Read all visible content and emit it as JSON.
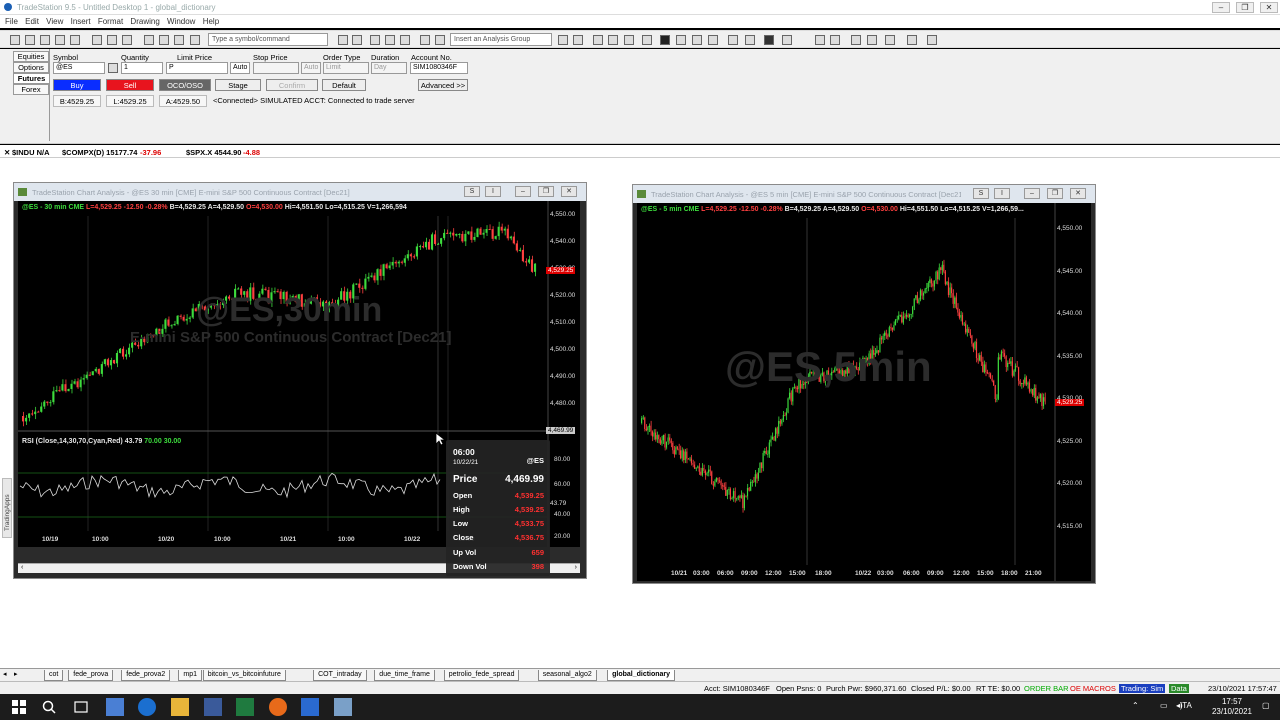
{
  "window": {
    "title": "TradeStation 9.5 - Untitled Desktop 1 - global_dictionary"
  },
  "menu": [
    "File",
    "Edit",
    "View",
    "Insert",
    "Format",
    "Drawing",
    "Window",
    "Help"
  ],
  "toolbar": {
    "command_placeholder": "Type a symbol/command",
    "analysis_group": "Insert an Analysis Group"
  },
  "order_bar": {
    "asset_tabs": [
      "Equities",
      "Options",
      "Futures",
      "Forex"
    ],
    "labels": {
      "symbol": "Symbol",
      "quantity": "Quantity",
      "limit_price": "Limit Price",
      "stop_price": "Stop Price",
      "order_type": "Order Type",
      "duration": "Duration",
      "account": "Account No."
    },
    "values": {
      "symbol": "@ES",
      "quantity": "1",
      "limit_price": "P",
      "limit_auto": "Auto",
      "stop_auto": "Auto",
      "order_type": "Limit",
      "duration": "Day",
      "account": "SIM1080346F"
    },
    "buttons": {
      "buy": "Buy",
      "sell": "Sell",
      "oco": "OCO/OSO",
      "stage": "Stage",
      "confirm": "Confirm",
      "default": "Default",
      "advanced": "Advanced >>"
    },
    "quotes": {
      "bid": "B:4529.25",
      "last": "L:4529.25",
      "ask": "A:4529.50"
    },
    "connection": "<Connected> SIMULATED ACCT: Connected to trade server"
  },
  "ticker": [
    {
      "symbol": "$INDU N/A",
      "change": ""
    },
    {
      "symbol": "$COMPX(D) 15177.74",
      "change": "-37.96"
    },
    {
      "symbol": "$SPX.X 4544.90",
      "change": "-4.88"
    }
  ],
  "side_panel": {
    "label": "TradingApps"
  },
  "chart1": {
    "title": "TradeStation Chart Analysis - @ES 30 min [CME] E-mini S&P 500 Continuous Contract [Dec21]",
    "head_buttons": {
      "s": "S",
      "i": "I"
    },
    "info": {
      "symbol": "@ES - 30 min",
      "exchange": "CME",
      "last": "L=4,529.25",
      "change": "-12.50",
      "pct": "-0.28%",
      "bid": "B=4,529.25",
      "ask": "A=4,529.50",
      "open": "O=4,530.00",
      "high": "Hi=4,551.50",
      "low": "Lo=4,515.25",
      "vol": "V=1,266,594"
    },
    "watermark": "@ES,30min",
    "watermark2": "E-mini S&P 500 Continuous Contract [Dec21]",
    "price_axis": [
      "4,550.00",
      "4,540.00",
      "4,530.00",
      "4,520.00",
      "4,510.00",
      "4,500.00",
      "4,490.00",
      "4,480.00"
    ],
    "last_tag": "4,529.25",
    "cursor_tag": "4,469.99",
    "rsi_label": "RSI (Close,14,30,70,Cyan,Red)",
    "rsi_value": "43.79",
    "rsi_upper": "70.00",
    "rsi_lower": "30.00",
    "rsi_axis": [
      "80.00",
      "60.00",
      "43.79",
      "40.00",
      "20.00"
    ],
    "time_axis": [
      "10/19",
      "10:00",
      "10/20",
      "10:00",
      "10/21",
      "10:00",
      "10/22",
      "10:00"
    ]
  },
  "chart2": {
    "title": "TradeStation Chart Analysis - @ES 5 min [CME] E-mini S&P 500 Continuous Contract [Dec21]",
    "head_buttons": {
      "s": "S",
      "i": "I"
    },
    "info": {
      "symbol": "@ES - 5 min",
      "exchange": "CME",
      "last": "L=4,529.25",
      "change": "-12.50",
      "pct": "-0.28%",
      "bid": "B=4,529.25",
      "ask": "A=4,529.50",
      "open": "O=4,530.00",
      "high": "Hi=4,551.50",
      "low": "Lo=4,515.25",
      "vol": "V=1,266,59..."
    },
    "watermark": "@ES,5min",
    "price_axis": [
      "4,550.00",
      "4,545.00",
      "4,540.00",
      "4,535.00",
      "4,530.00",
      "4,525.00",
      "4,520.00",
      "4,515.00"
    ],
    "last_tag": "4,529.25",
    "time_axis": [
      "10/21",
      "03:00",
      "06:00",
      "09:00",
      "12:00",
      "15:00",
      "18:00",
      "10/22",
      "03:00",
      "06:00",
      "09:00",
      "12:00",
      "15:00",
      "18:00",
      "21:00"
    ]
  },
  "tooltip": {
    "time": "06:00",
    "date": "10/22/21",
    "symbol": "@ES",
    "price_label": "Price",
    "price": "4,469.99",
    "open_label": "Open",
    "open": "4,539.25",
    "high_label": "High",
    "high": "4,539.25",
    "low_label": "Low",
    "low": "4,533.75",
    "close_label": "Close",
    "close": "4,536.75",
    "upvol_label": "Up Vol",
    "upvol": "659",
    "downvol_label": "Down Vol",
    "downvol": "398"
  },
  "sheet_tabs": [
    "cot",
    "fede_prova",
    "fede_prova2",
    "mp1",
    "bitcoin_vs_bitcoinfuture",
    "COT_intraday",
    "due_time_frame",
    "petrolio_fede_spread",
    "seasonal_algo2",
    "global_dictionary"
  ],
  "status": {
    "account": "Acct: SIM1080346F",
    "open_psns": "Open Psns: 0",
    "purch_pwr": "Purch Pwr: $960,371.60",
    "closed_pl": "Closed P/L: $0.00",
    "rt_te": "RT TE: $0.00",
    "order_bar": "ORDER BAR",
    "oe_macros": "OE MACROS",
    "trading": "Trading: Sim",
    "data": "Data",
    "datetime": "23/10/2021 17:57:47"
  },
  "taskbar": {
    "lang": "ITA",
    "time": "17:57",
    "date": "23/10/2021"
  },
  "colors": {
    "up": "#3ddc3d",
    "down": "#ff4040",
    "buy": "#0a2dff",
    "sell": "#e8141e"
  }
}
